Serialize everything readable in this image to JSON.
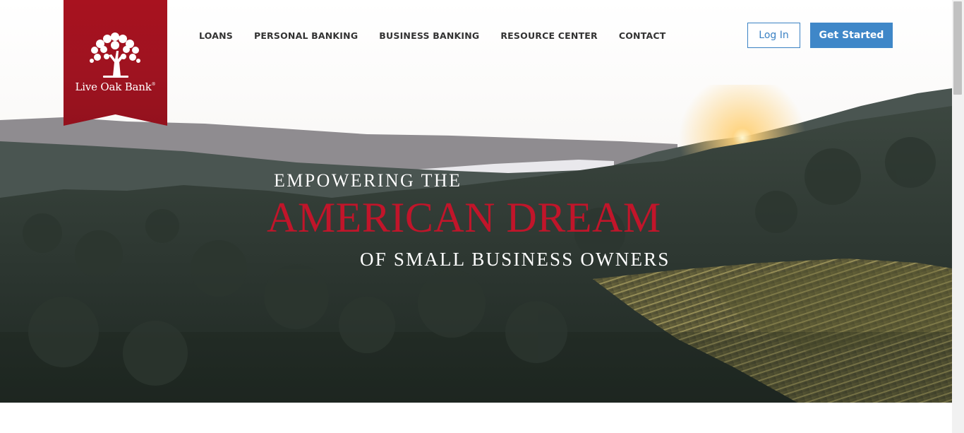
{
  "logo": {
    "name": "Live Oak Bank",
    "mark": "®"
  },
  "nav": {
    "items": [
      {
        "label": "LOANS"
      },
      {
        "label": "PERSONAL BANKING"
      },
      {
        "label": "BUSINESS BANKING"
      },
      {
        "label": "RESOURCE CENTER"
      },
      {
        "label": "CONTACT"
      }
    ]
  },
  "header": {
    "login_label": "Log In",
    "get_started_label": "Get Started"
  },
  "hero": {
    "line1": "EMPOWERING THE",
    "line2": "AMERICAN DREAM",
    "line3": "OF SMALL BUSINESS OWNERS"
  },
  "colors": {
    "brand_red": "#a8121f",
    "headline_red": "#c1152a",
    "button_blue": "#3f87c8",
    "nav_text": "#333333"
  }
}
